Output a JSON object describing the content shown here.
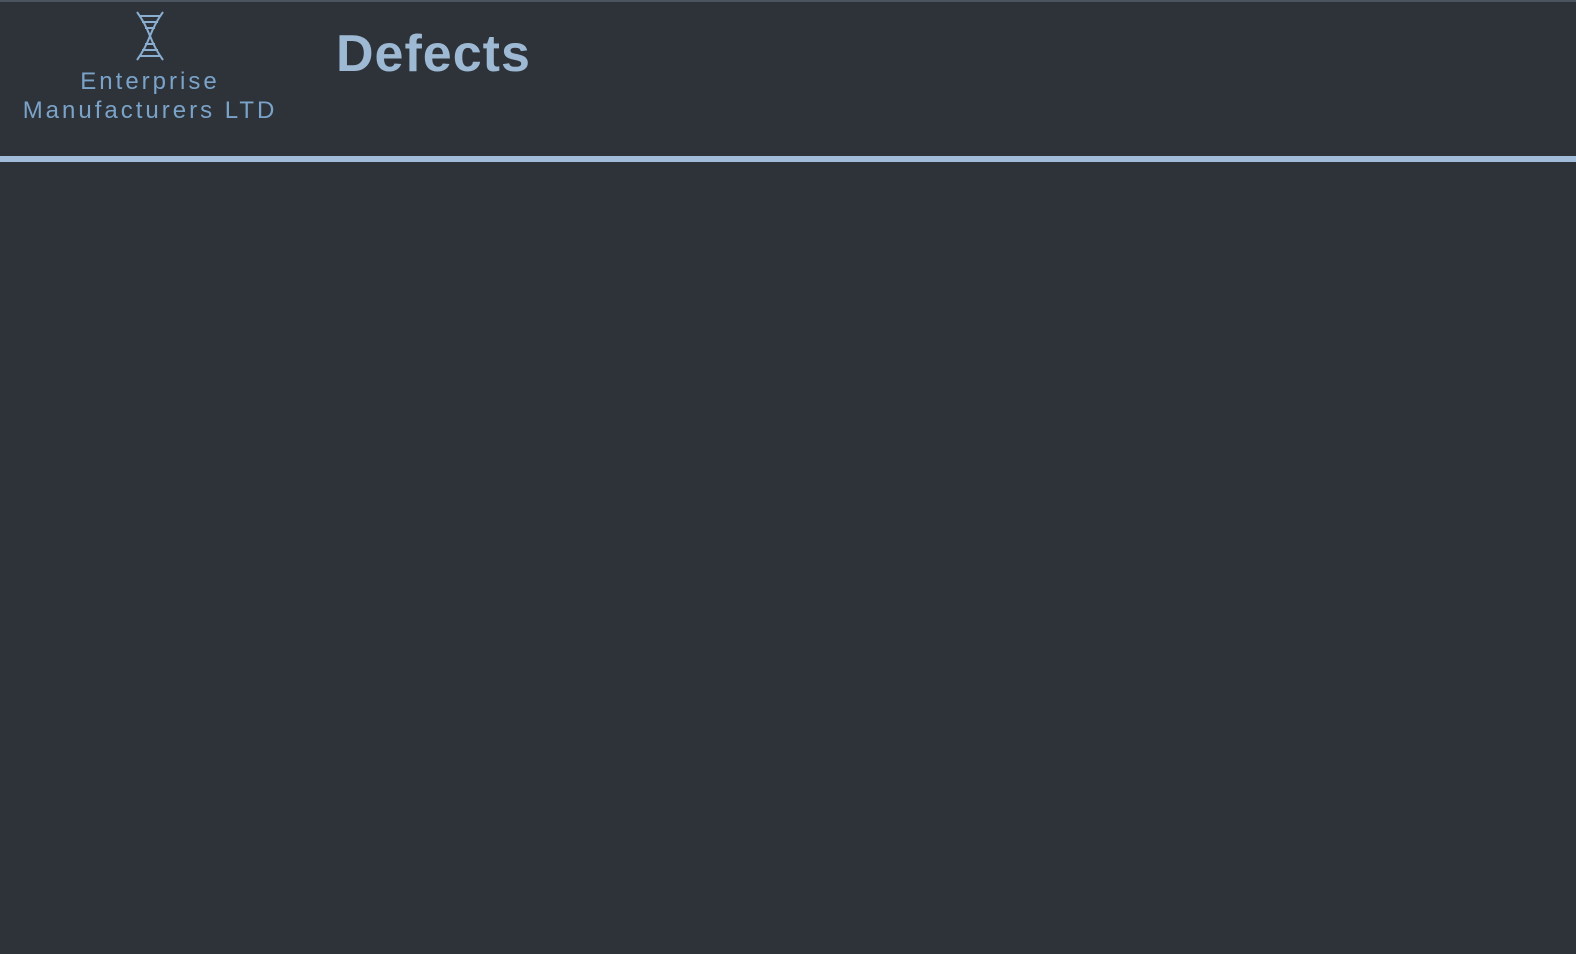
{
  "header": {
    "company_line1": "Enterprise",
    "company_line2": "Manufacturers LTD",
    "page_title": "Defects"
  }
}
